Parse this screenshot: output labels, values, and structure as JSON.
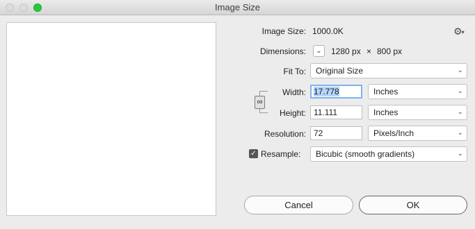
{
  "window": {
    "title": "Image Size"
  },
  "image_size": {
    "label": "Image Size:",
    "value": "1000.0K"
  },
  "dimensions": {
    "label": "Dimensions:",
    "width": "1280 px",
    "separator": "×",
    "height": "800 px"
  },
  "fit_to": {
    "label": "Fit To:",
    "selected": "Original Size"
  },
  "width": {
    "label": "Width:",
    "value": "17.778",
    "unit": "Inches"
  },
  "height": {
    "label": "Height:",
    "value": "11.111",
    "unit": "Inches"
  },
  "resolution": {
    "label": "Resolution:",
    "value": "72",
    "unit": "Pixels/Inch"
  },
  "resample": {
    "label": "Resample:",
    "checked": true,
    "method": "Bicubic (smooth gradients)"
  },
  "buttons": {
    "cancel": "Cancel",
    "ok": "OK"
  },
  "icons": {
    "gear": "gear-icon",
    "chevron": "chevron-down-icon",
    "link": "chain-link-icon",
    "check": "checkmark-icon"
  },
  "colors": {
    "zoom_light": "#28c840",
    "focus_ring": "#7fb2ee",
    "selection": "#b4d4fb"
  }
}
